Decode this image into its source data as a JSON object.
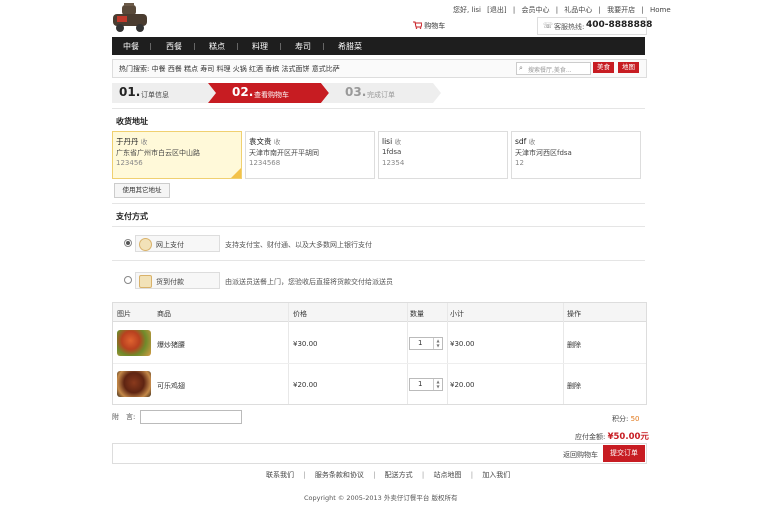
{
  "header": {
    "greeting": "您好, lisi",
    "logout": "[退出]",
    "links": [
      "会员中心",
      "礼品中心",
      "我要开店",
      "Home"
    ],
    "cart_label": "购物车",
    "hotline_label": "客服热线:",
    "hotline_number": "400-8888888"
  },
  "nav": {
    "items": [
      "中餐",
      "西餐",
      "糕点",
      "料理",
      "寿司",
      "希腊菜"
    ]
  },
  "hot_search": {
    "label": "热门搜索:",
    "terms": [
      "中餐",
      "西餐",
      "糕点",
      "寿司",
      "料理",
      "火锅",
      "红酒",
      "香槟",
      "法式面饼",
      "意式比萨"
    ],
    "search_placeholder": "搜索餐厅,美食...",
    "btn_food": "美食",
    "btn_map": "地图"
  },
  "steps": [
    {
      "num": "01.",
      "label": "订单信息"
    },
    {
      "num": "02.",
      "label": "查看购物车"
    },
    {
      "num": "03.",
      "label": "完成订单"
    }
  ],
  "address": {
    "title": "收货地址",
    "items": [
      {
        "name": "于丹丹",
        "suffix": "收",
        "line": "广东省广州市白云区中山路",
        "zip": "123456"
      },
      {
        "name": "袁文贵",
        "suffix": "收",
        "line": "天津市南开区开平胡同",
        "zip": "1234568"
      },
      {
        "name": "lisi",
        "suffix": "收",
        "line": "1fdsa",
        "zip": "12354"
      },
      {
        "name": "sdf",
        "suffix": "收",
        "line": "天津市河西区fdsa",
        "zip": "12"
      }
    ],
    "other_button": "使用其它地址"
  },
  "payment": {
    "title": "支付方式",
    "options": [
      {
        "label": "网上支付",
        "desc": "支持支付宝、财付通、以及大多数网上银行支付"
      },
      {
        "label": "货到付款",
        "desc": "由派送员送餐上门，您验收后直接将货款交付给派送员"
      }
    ]
  },
  "table": {
    "headers": [
      "图片",
      "商品",
      "价格",
      "数量",
      "小计",
      "操作"
    ],
    "rows": [
      {
        "name": "爆炒猪腰",
        "price": "¥30.00",
        "qty": "1",
        "subtotal": "¥30.00",
        "op": "删除"
      },
      {
        "name": "可乐鸡翅",
        "price": "¥20.00",
        "qty": "1",
        "subtotal": "¥20.00",
        "op": "删除"
      }
    ]
  },
  "summary": {
    "note_label": "附　言:",
    "points_label": "积分:",
    "points_value": "50",
    "total_label": "应付金额:",
    "total_value": "¥50.00元",
    "back_link": "返回购物车",
    "submit": "提交订单"
  },
  "footer": {
    "links": [
      "联系我们",
      "服务条款和协议",
      "配送方式",
      "站点地图",
      "加入我们"
    ],
    "copyright": "Copyright © 2005-2013 外卖仔订餐平台 版权所有"
  }
}
